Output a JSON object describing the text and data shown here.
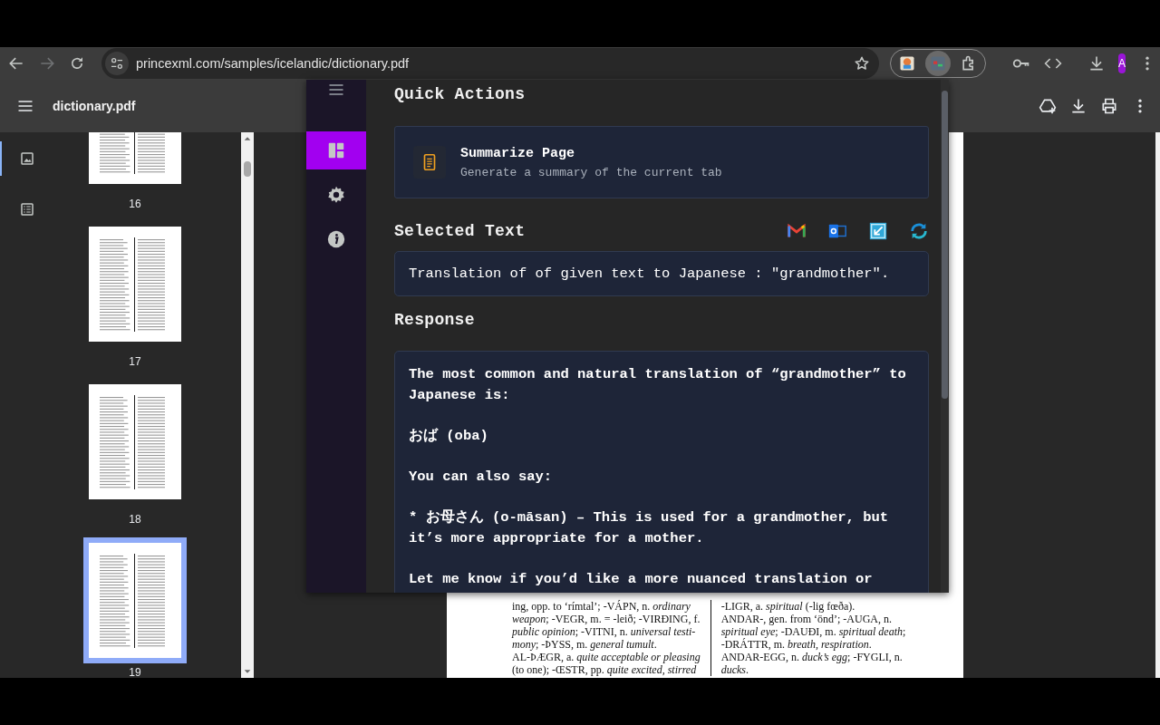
{
  "browser": {
    "back_disabled": false,
    "forward_disabled": true,
    "url": "princexml.com/samples/icelandic/dictionary.pdf",
    "extensions": [
      {
        "selected": false
      },
      {
        "selected": true
      },
      {
        "selected": false
      }
    ],
    "profile_initial": "A"
  },
  "pdf_viewer": {
    "title": "dictionary.pdf",
    "sidebar_tabs": [
      {
        "selected": true
      },
      {
        "selected": false
      }
    ],
    "thumbnails": [
      {
        "label": "16",
        "selected": false
      },
      {
        "label": "17",
        "selected": false
      },
      {
        "label": "18",
        "selected": false
      },
      {
        "label": "19",
        "selected": true
      }
    ],
    "page": {
      "column_1": [
        "ing, opp. to ‘rímtal’; -VÁPN, n. *ordinary*",
        "*weapon*; -VEGR, m. = -leið; -VIRÐING, f.",
        "*public opinion*; -VITNI, n. *universal testi-*",
        "*mony*; -ÞYSS, m. *general tumult*.",
        "AL-ÞÆGR, a. *quite acceptable or pleasing*",
        "(to one); -ŒSTR, pp. *quite excited, stirred*"
      ],
      "column_2": [
        "-LIGR, a. *spiritual* (-lig fœða).",
        "ANDAR-, gen. from ‘önd’; -AUGA, n.",
        "*spiritual eye*; -DAUÐI, m. *spiritual death*;",
        "-DRÁTTR, m. *breath, respiration*.",
        "ANDAR-EGG, n. *duck’s egg*; -FYGLI, n.",
        "*ducks*."
      ]
    }
  },
  "extension_popup": {
    "nav_items": [
      {
        "selected": true
      },
      {
        "selected": false
      },
      {
        "selected": false
      }
    ],
    "quick_actions": {
      "heading": "Quick Actions",
      "actions": [
        {
          "title": "Summarize Page",
          "description": "Generate a summary of the current tab"
        }
      ]
    },
    "selected_text": {
      "heading": "Selected Text",
      "text": "Translation of of given text to Japanese : \"grandmother\"."
    },
    "response": {
      "heading": "Response",
      "paragraphs": [
        "The most common and natural translation of “grandmother” to Japanese is:",
        "おば (oba)",
        "You can also say:",
        "* お母さん (o-māsan) – This is used for a grandmother, but it’s more appropriate for a mother.",
        "Let me know if you’d like a more nuanced translation or"
      ]
    }
  }
}
